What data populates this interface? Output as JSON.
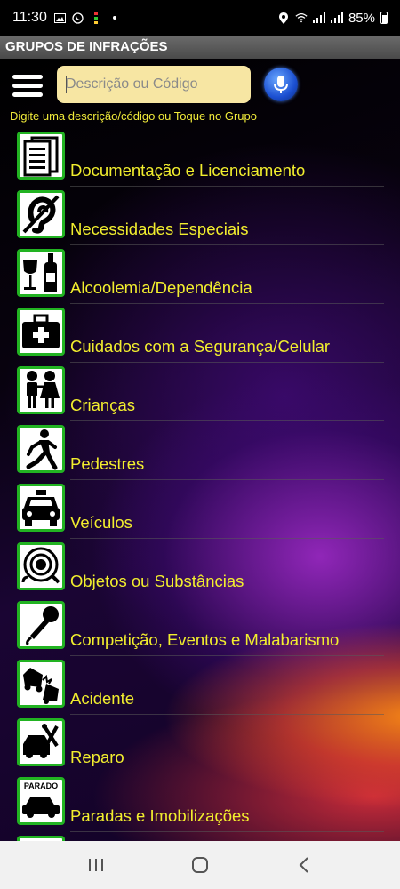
{
  "status_bar": {
    "time": "11:30",
    "battery": "85%"
  },
  "app": {
    "title": "GRUPOS DE INFRAÇÕES"
  },
  "search": {
    "placeholder": "Descrição ou Código",
    "value": ""
  },
  "hint": "Digite uma descrição/código ou Toque no Grupo",
  "groups": [
    {
      "label": "Documentação e Licenciamento",
      "icon": "document-icon"
    },
    {
      "label": "Necessidades Especiais",
      "icon": "hearing-impaired-icon"
    },
    {
      "label": "Alcoolemia/Dependência",
      "icon": "wine-bottle-icon"
    },
    {
      "label": "Cuidados com a Segurança/Celular",
      "icon": "first-aid-kit-icon"
    },
    {
      "label": "Crianças",
      "icon": "children-icon"
    },
    {
      "label": "Pedestres",
      "icon": "pedestrian-icon"
    },
    {
      "label": "Veículos",
      "icon": "taxi-icon"
    },
    {
      "label": "Objetos ou Substâncias",
      "icon": "cup-icon"
    },
    {
      "label": "Competição, Eventos e Malabarismo",
      "icon": "microphone-icon"
    },
    {
      "label": "Acidente",
      "icon": "car-crash-icon"
    },
    {
      "label": "Reparo",
      "icon": "car-repair-icon"
    },
    {
      "label": "Paradas e Imobilizações",
      "icon": "parked-car-icon",
      "icon_text": "PARADO"
    }
  ],
  "colors": {
    "accent_text": "#f2ee2e",
    "icon_border": "#22b322",
    "search_bg": "#f7e6a3"
  }
}
